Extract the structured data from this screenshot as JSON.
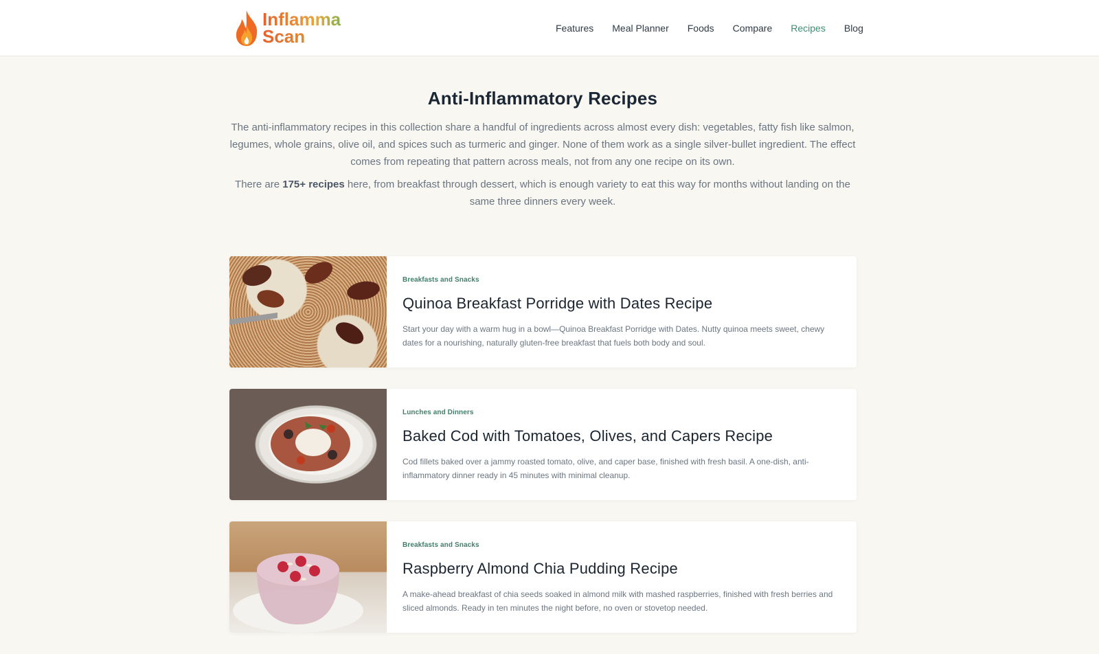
{
  "brand": {
    "line1": "Inflamma",
    "line2": "Scan"
  },
  "nav": {
    "items": [
      {
        "label": "Features"
      },
      {
        "label": "Meal Planner"
      },
      {
        "label": "Foods"
      },
      {
        "label": "Compare"
      },
      {
        "label": "Recipes"
      },
      {
        "label": "Blog"
      }
    ],
    "active": "Recipes"
  },
  "hero": {
    "title": "Anti-Inflammatory Recipes",
    "intro": "The anti-inflammatory recipes in this collection share a handful of ingredients across almost every dish: vegetables, fatty fish like salmon, legumes, whole grains, olive oil, and spices such as turmeric and ginger. None of them work as a single silver-bullet ingredient. The effect comes from repeating that pattern across meals, not from any one recipe on its own.",
    "count_prefix": "There are ",
    "count": "175+ recipes",
    "count_suffix": " here, from breakfast through dessert, which is enough variety to eat this way for months without landing on the same three dinners every week."
  },
  "recipes": [
    {
      "category": "Breakfasts and Snacks",
      "title": "Quinoa Breakfast Porridge with Dates Recipe",
      "description": "Start your day with a warm hug in a bowl—Quinoa Breakfast Porridge with Dates. Nutty quinoa meets sweet, chewy dates for a nourishing, naturally gluten-free breakfast that fuels both body and soul."
    },
    {
      "category": "Lunches and Dinners",
      "title": "Baked Cod with Tomatoes, Olives, and Capers Recipe",
      "description": "Cod fillets baked over a jammy roasted tomato, olive, and caper base, finished with fresh basil. A one-dish, anti-inflammatory dinner ready in 45 minutes with minimal cleanup."
    },
    {
      "category": "Breakfasts and Snacks",
      "title": "Raspberry Almond Chia Pudding Recipe",
      "description": "A make-ahead breakfast of chia seeds soaked in almond milk with mashed raspberries, finished with fresh berries and sliced almonds. Ready in ten minutes the night before, no oven or stovetop needed."
    }
  ],
  "colors": {
    "accent": "#3f8c74",
    "background": "#f8f7f2"
  }
}
